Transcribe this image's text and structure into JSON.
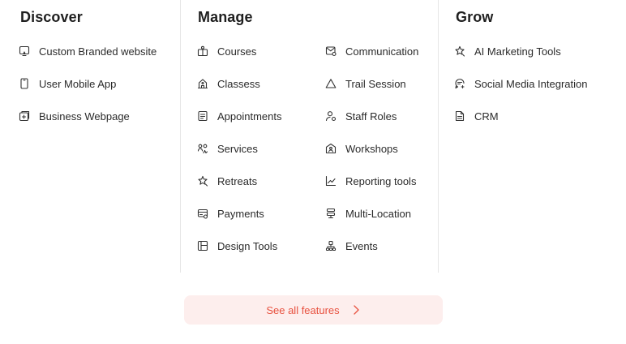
{
  "discover": {
    "title": "Discover",
    "items": [
      {
        "label": "Custom Branded website",
        "icon": "monitor-icon"
      },
      {
        "label": "User Mobile App",
        "icon": "mobile-icon"
      },
      {
        "label": "Business Webpage",
        "icon": "webpage-icon"
      }
    ]
  },
  "manage": {
    "title": "Manage",
    "left_items": [
      {
        "label": "Courses",
        "icon": "courses-icon"
      },
      {
        "label": "Classess",
        "icon": "classes-icon"
      },
      {
        "label": "Appointments",
        "icon": "appointments-icon"
      },
      {
        "label": "Services",
        "icon": "services-icon"
      },
      {
        "label": "Retreats",
        "icon": "retreats-icon"
      },
      {
        "label": "Payments",
        "icon": "payments-icon"
      },
      {
        "label": "Design Tools",
        "icon": "design-tools-icon"
      }
    ],
    "right_items": [
      {
        "label": "Communication",
        "icon": "communication-icon"
      },
      {
        "label": "Trail Session",
        "icon": "trail-session-icon"
      },
      {
        "label": "Staff Roles",
        "icon": "staff-roles-icon"
      },
      {
        "label": "Workshops",
        "icon": "workshops-icon"
      },
      {
        "label": "Reporting tools",
        "icon": "reporting-icon"
      },
      {
        "label": "Multi-Location",
        "icon": "multi-location-icon"
      },
      {
        "label": "Events",
        "icon": "events-icon"
      }
    ]
  },
  "grow": {
    "title": "Grow",
    "items": [
      {
        "label": "AI Marketing Tools",
        "icon": "sparkle-icon"
      },
      {
        "label": "Social Media Integration",
        "icon": "social-icon"
      },
      {
        "label": "CRM",
        "icon": "document-icon"
      }
    ]
  },
  "see_all": {
    "label": "See all features",
    "icon": "chevron-right-icon"
  },
  "colors": {
    "accent": "#e8513f",
    "accent_bg": "#fdeeed",
    "divider": "#e6e6e6",
    "text": "#2a2a2a"
  }
}
